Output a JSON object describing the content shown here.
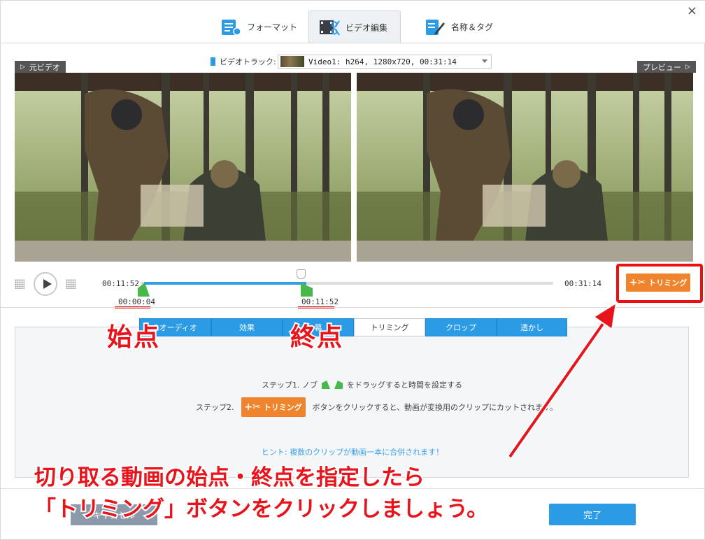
{
  "window": {
    "close_glyph": "×"
  },
  "top_tabs": [
    {
      "label": "フォーマット",
      "icon": "format-icon",
      "active": false
    },
    {
      "label": "ビデオ編集",
      "icon": "video-edit-icon",
      "active": true
    },
    {
      "label": "名称＆タグ",
      "icon": "name-tag-icon",
      "active": false
    }
  ],
  "track": {
    "label": "ビデオトラック:",
    "selected": "Video1: h264, 1280x720, 00:31:14"
  },
  "panes": {
    "original_label": "元ビデオ",
    "preview_label": "プレビュー"
  },
  "playback": {
    "current_time": "00:11:52",
    "total_time": "00:31:14",
    "start_marker": "00:00:04",
    "end_marker": "00:11:52",
    "trim_button": "トリミング"
  },
  "sub_tabs": [
    {
      "label": "&オーディオ",
      "active": false
    },
    {
      "label": "効果",
      "active": false
    },
    {
      "label": "幕",
      "active": false
    },
    {
      "label": "トリミング",
      "active": true
    },
    {
      "label": "クロップ",
      "active": false
    },
    {
      "label": "透かし",
      "active": false
    }
  ],
  "instructions": {
    "step1_prefix": "ステップ1. ノブ",
    "step1_suffix": "をドラッグすると時間を設定する",
    "step2_prefix": "ステップ2.",
    "step2_button": "トリミング",
    "step2_suffix": "ボタンをクリックすると、動画が変換用のクリップにカットされます。",
    "hint": "ヒント: 複数のクリップが動画一本に合併されます！"
  },
  "footer": {
    "cancel_label": "キャンセル",
    "done_label": "完了"
  },
  "annotations": {
    "start_point": "始点",
    "end_point": "終点",
    "message_line1": "切り取る動画の始点・終点を指定したら",
    "message_line2": "「トリミング」ボタンをクリックしましょう。"
  },
  "colors": {
    "accent_blue": "#2b9be6",
    "trim_orange": "#f0842c",
    "annotation_red": "#e8141c",
    "marker_green": "#46b94a"
  }
}
